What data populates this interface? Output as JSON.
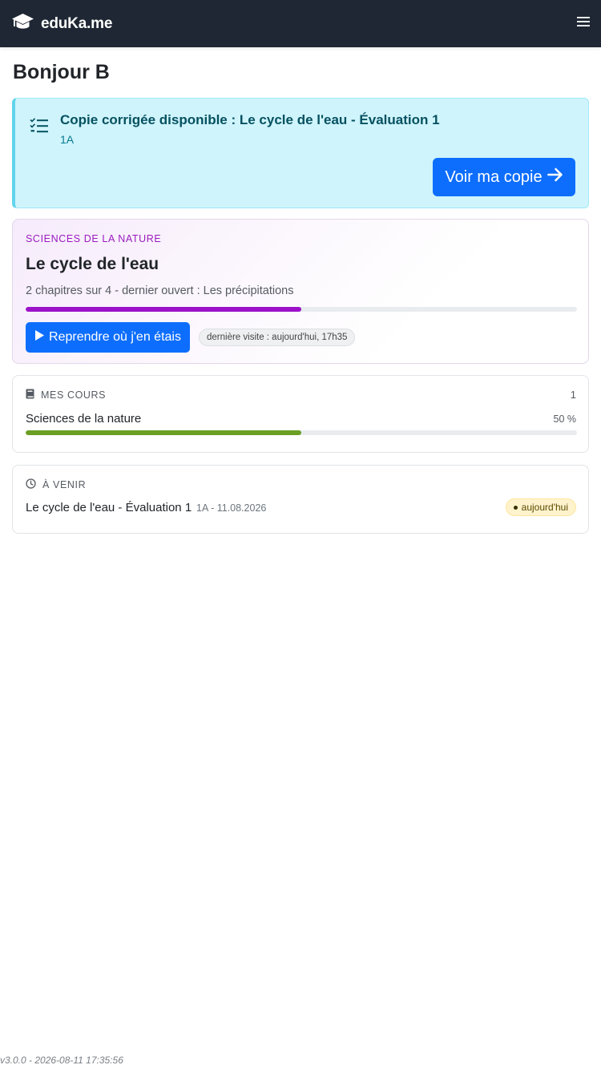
{
  "app": {
    "brand": "eduKa.me"
  },
  "greeting": "Bonjour B",
  "alert": {
    "title": "Copie corrigée disponible : Le cycle de l'eau - Évaluation 1",
    "class": "1A",
    "button_label": "Voir ma copie"
  },
  "resume": {
    "subject": "SCIENCES DE LA NATURE",
    "title": "Le cycle de l'eau",
    "progress_text": "2 chapitres sur 4 - dernier ouvert : Les précipitations",
    "progress_fraction": 0.5,
    "button_label": "Reprendre où j'en étais",
    "last_visit": "dernière visite : aujourd'hui, 17h35",
    "color": "#9b12c9"
  },
  "my_courses": {
    "heading": "MES COURS",
    "count": "1",
    "items": [
      {
        "name": "Sciences de la nature",
        "percent_label": "50 %",
        "progress_fraction": 0.5,
        "color": "#6a9f23"
      }
    ]
  },
  "upcoming": {
    "heading": "À VENIR",
    "items": [
      {
        "title": "Le cycle de l'eau - Évaluation 1",
        "meta": "1A - 11.08.2026",
        "badge": "aujourd'hui"
      }
    ]
  },
  "footer": {
    "version": "v3.0.0 - 2026-08-11 17:35:56"
  }
}
